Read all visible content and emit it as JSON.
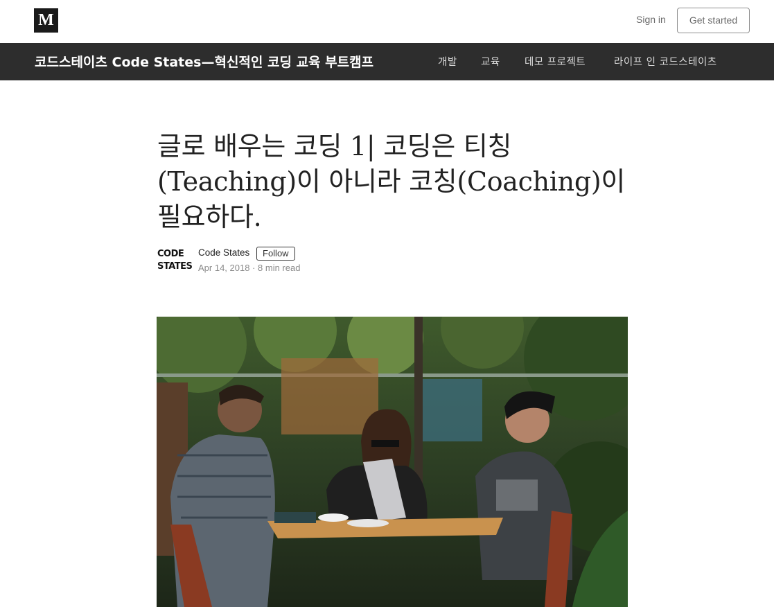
{
  "header": {
    "logo": "M",
    "sign_in": "Sign in",
    "get_started": "Get started"
  },
  "publication": {
    "title": "코드스테이츠 Code States—혁신적인 코딩 교육 부트캠프",
    "nav": [
      "개발",
      "교육",
      "데모 프로젝트",
      "라이프 인 코드스테이츠"
    ]
  },
  "article": {
    "title": "글로 배우는 코딩 1| 코딩은 티칭(Teaching)이 아니라 코칭(Coaching)이 필요하다.",
    "author_logo_line1": "CODE",
    "author_logo_line2": "STATES",
    "author": "Code States",
    "follow": "Follow",
    "date": "Apr 14, 2018",
    "read_time": "8 min read",
    "hero_image": "photo-four-people-at-cafe-table-with-laptop"
  },
  "colors": {
    "pub_bar": "#2d2d2d",
    "logo_bg": "#1a1a1a",
    "title_text": "#222222"
  }
}
